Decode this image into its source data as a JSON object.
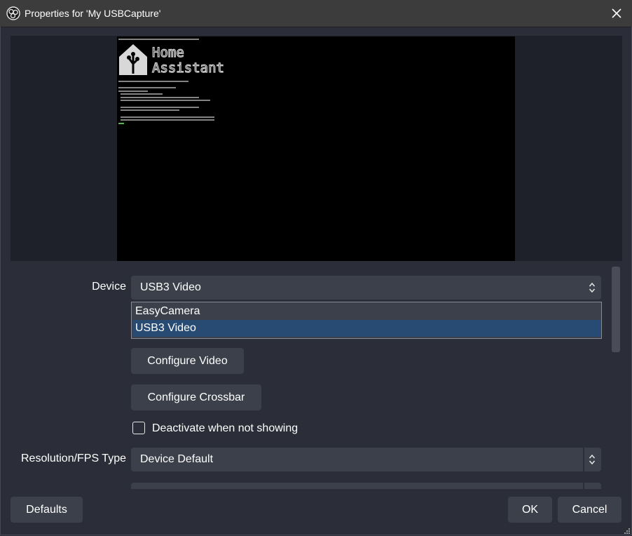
{
  "window": {
    "title": "Properties for 'My USBCapture'",
    "app_icon": "obs-logo-icon",
    "close_icon": "close-icon"
  },
  "preview": {
    "content": "capture-preview",
    "screen_heading": "Home Assistant"
  },
  "device": {
    "label": "Device",
    "value": "USB3 Video",
    "options": [
      "EasyCamera",
      "USB3 Video"
    ]
  },
  "buttons": {
    "configure_video": "Configure Video",
    "configure_crossbar": "Configure Crossbar"
  },
  "deactivate": {
    "label": "Deactivate when not showing",
    "checked": false
  },
  "resolution": {
    "label": "Resolution/FPS Type",
    "value": "Device Default"
  },
  "footer": {
    "defaults": "Defaults",
    "ok": "OK",
    "cancel": "Cancel"
  },
  "colors": {
    "selection": "#284b73",
    "background": "#2b2e38",
    "control": "#3c404b",
    "preview_bg": "#1f212a"
  }
}
